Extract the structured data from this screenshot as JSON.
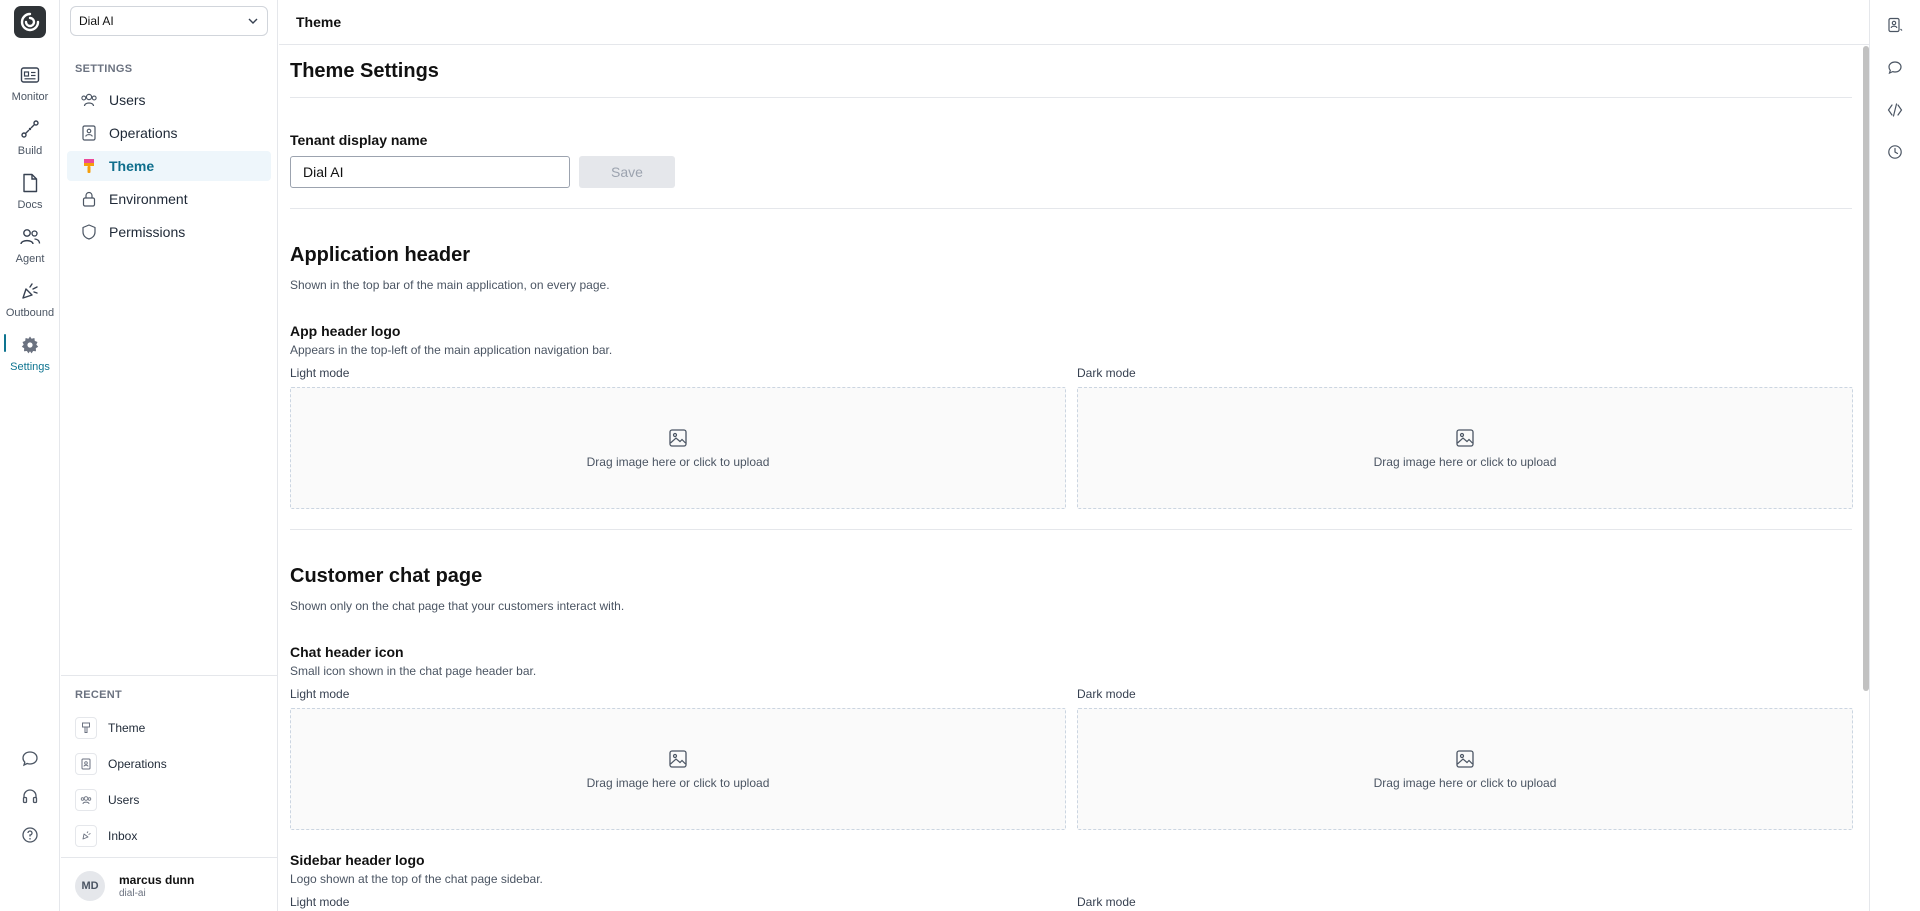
{
  "rail": {
    "items": [
      {
        "label": "Monitor",
        "icon": "monitor-icon"
      },
      {
        "label": "Build",
        "icon": "build-icon"
      },
      {
        "label": "Docs",
        "icon": "docs-icon"
      },
      {
        "label": "Agent",
        "icon": "agent-icon"
      },
      {
        "label": "Outbound",
        "icon": "outbound-icon"
      },
      {
        "label": "Settings",
        "icon": "gear-icon",
        "active": true
      }
    ],
    "bottom_icons": [
      "chat-icon",
      "headset-icon",
      "help-icon"
    ]
  },
  "sidebar": {
    "tenant": "Dial AI",
    "section_label": "SETTINGS",
    "items": [
      {
        "label": "Users",
        "icon": "users-icon"
      },
      {
        "label": "Operations",
        "icon": "operations-icon"
      },
      {
        "label": "Theme",
        "icon": "theme-icon",
        "active": true
      },
      {
        "label": "Environment",
        "icon": "lock-icon"
      },
      {
        "label": "Permissions",
        "icon": "shield-icon"
      }
    ],
    "recent_label": "RECENT",
    "recent": [
      {
        "label": "Theme"
      },
      {
        "label": "Operations"
      },
      {
        "label": "Users"
      },
      {
        "label": "Inbox"
      }
    ],
    "user": {
      "initials": "MD",
      "name": "marcus dunn",
      "org": "dial-ai"
    }
  },
  "topbar": {
    "title": "Theme"
  },
  "right_rail": {
    "icons": [
      "contact-icon",
      "conversation-icon",
      "code-icon",
      "history-icon"
    ]
  },
  "main": {
    "page_title": "Theme Settings",
    "tenant_field": {
      "label": "Tenant display name",
      "value": "Dial AI",
      "save_label": "Save"
    },
    "app_header": {
      "title": "Application header",
      "description": "Shown in the top bar of the main application, on every page.",
      "logo": {
        "title": "App header logo",
        "description": "Appears in the top-left of the main application navigation bar.",
        "light_label": "Light mode",
        "dark_label": "Dark mode",
        "drop_text": "Drag image here or click to upload"
      }
    },
    "chat_page": {
      "title": "Customer chat page",
      "description": "Shown only on the chat page that your customers interact with.",
      "header_icon": {
        "title": "Chat header icon",
        "description": "Small icon shown in the chat page header bar.",
        "light_label": "Light mode",
        "dark_label": "Dark mode",
        "drop_text": "Drag image here or click to upload"
      },
      "sidebar_logo": {
        "title": "Sidebar header logo",
        "description": "Logo shown at the top of the chat page sidebar.",
        "light_label": "Light mode",
        "dark_label": "Dark mode"
      }
    }
  },
  "colors": {
    "accent": "#0e7490",
    "active_bg": "#eef6fb",
    "border": "#e5e7eb"
  }
}
